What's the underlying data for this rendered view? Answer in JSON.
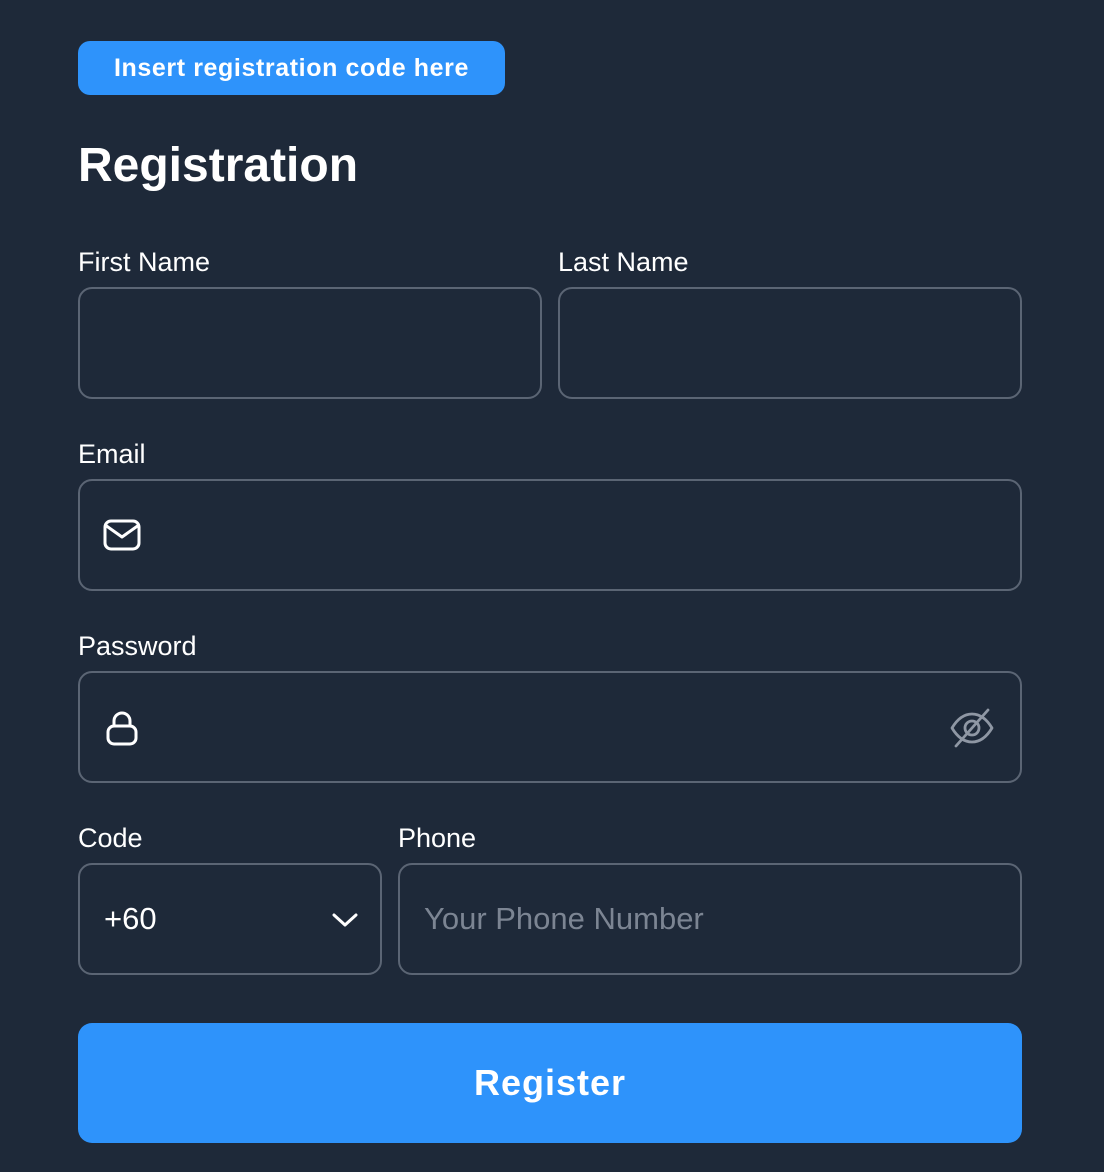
{
  "registration_code_button": {
    "label": "Insert registration code here"
  },
  "page_title": "Registration",
  "form": {
    "first_name": {
      "label": "First Name",
      "value": ""
    },
    "last_name": {
      "label": "Last Name",
      "value": ""
    },
    "email": {
      "label": "Email",
      "value": "",
      "icon": "mail-icon"
    },
    "password": {
      "label": "Password",
      "value": "",
      "icon": "lock-icon",
      "toggle_icon": "eye-off-icon"
    },
    "code": {
      "label": "Code",
      "selected": "+60",
      "icon": "chevron-down-icon"
    },
    "phone": {
      "label": "Phone",
      "value": "",
      "placeholder": "Your Phone Number"
    }
  },
  "register_button": {
    "label": "Register"
  },
  "colors": {
    "background": "#1e2939",
    "accent": "#2e93fb",
    "border": "#5b6574",
    "placeholder": "#7c8593"
  }
}
